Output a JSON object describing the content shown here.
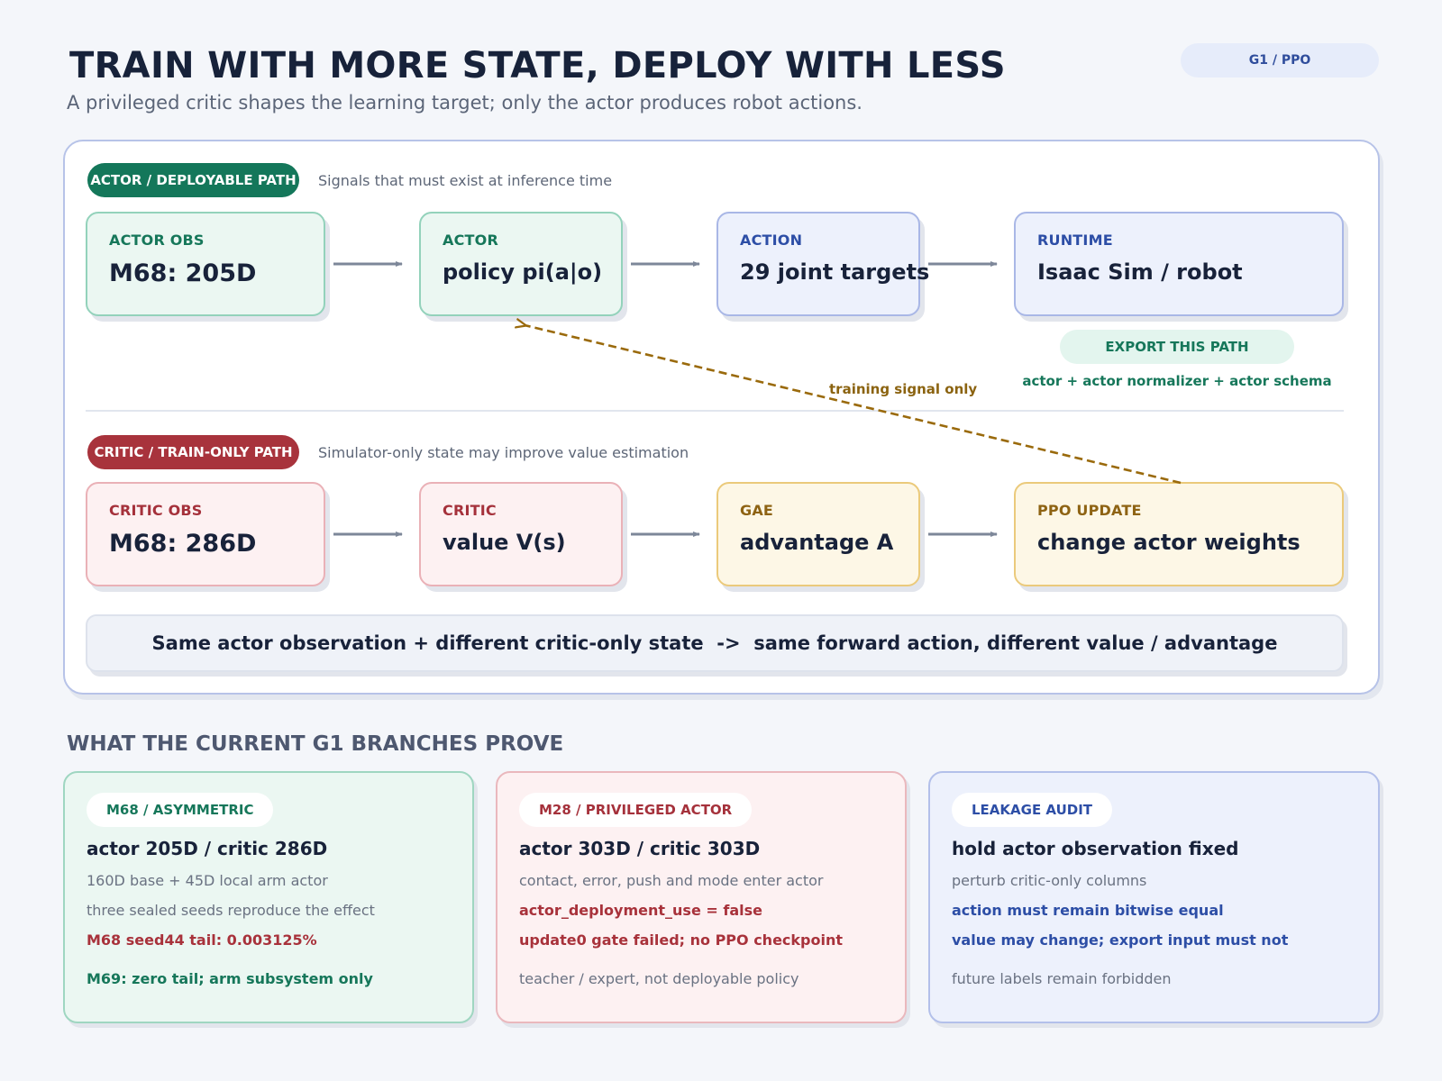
{
  "header": {
    "title": "TRAIN WITH MORE STATE, DEPLOY WITH LESS",
    "subtitle": "A privileged critic shapes the learning target; only the actor produces robot actions.",
    "badge": "G1 / PPO"
  },
  "actor_path": {
    "pill": "ACTOR / DEPLOYABLE PATH",
    "note": "Signals that must exist at inference time",
    "nodes": [
      {
        "label": "ACTOR OBS",
        "value": "M68: 205D"
      },
      {
        "label": "ACTOR",
        "value": "policy pi(a|o)"
      },
      {
        "label": "ACTION",
        "value": "29 joint targets"
      },
      {
        "label": "RUNTIME",
        "value": "Isaac Sim / robot"
      }
    ],
    "export_chip": "EXPORT THIS PATH",
    "export_note": "actor + actor normalizer + actor schema"
  },
  "training_signal_label": "training signal only",
  "critic_path": {
    "pill": "CRITIC / TRAIN-ONLY PATH",
    "note": "Simulator-only state may improve value estimation",
    "nodes": [
      {
        "label": "CRITIC OBS",
        "value": "M68: 286D"
      },
      {
        "label": "CRITIC",
        "value": "value V(s)"
      },
      {
        "label": "GAE",
        "value": "advantage A"
      },
      {
        "label": "PPO UPDATE",
        "value": "change actor weights"
      }
    ]
  },
  "summary": "Same actor observation + different critic-only state  ->  same forward action, different value / advantage",
  "section_title": "WHAT THE CURRENT G1 BRANCHES PROVE",
  "cards": [
    {
      "tag": "M68 / ASYMMETRIC",
      "head": "actor 205D / critic 286D",
      "line1": "160D base + 45D local arm actor",
      "line2": "three sealed seeds reproduce the effect",
      "line3": "M68 seed44 tail: 0.003125%",
      "line4": "M69: zero tail; arm subsystem only"
    },
    {
      "tag": "M28 / PRIVILEGED ACTOR",
      "head": "actor 303D / critic 303D",
      "line1": "contact, error, push and mode enter actor",
      "line2": "actor_deployment_use = false",
      "line3": "update0 gate failed; no PPO checkpoint",
      "line4": "teacher / expert, not deployable policy"
    },
    {
      "tag": "LEAKAGE AUDIT",
      "head": "hold actor observation fixed",
      "line1": "perturb critic-only columns",
      "line2": "action must remain bitwise equal",
      "line3": "value may change; export input must not",
      "line4": "future labels remain forbidden"
    }
  ],
  "colors": {
    "arrow": "#7d8799",
    "training_arrow": "#9a6a0c",
    "actor_green": "#14775a",
    "critic_red": "#a8333c"
  }
}
